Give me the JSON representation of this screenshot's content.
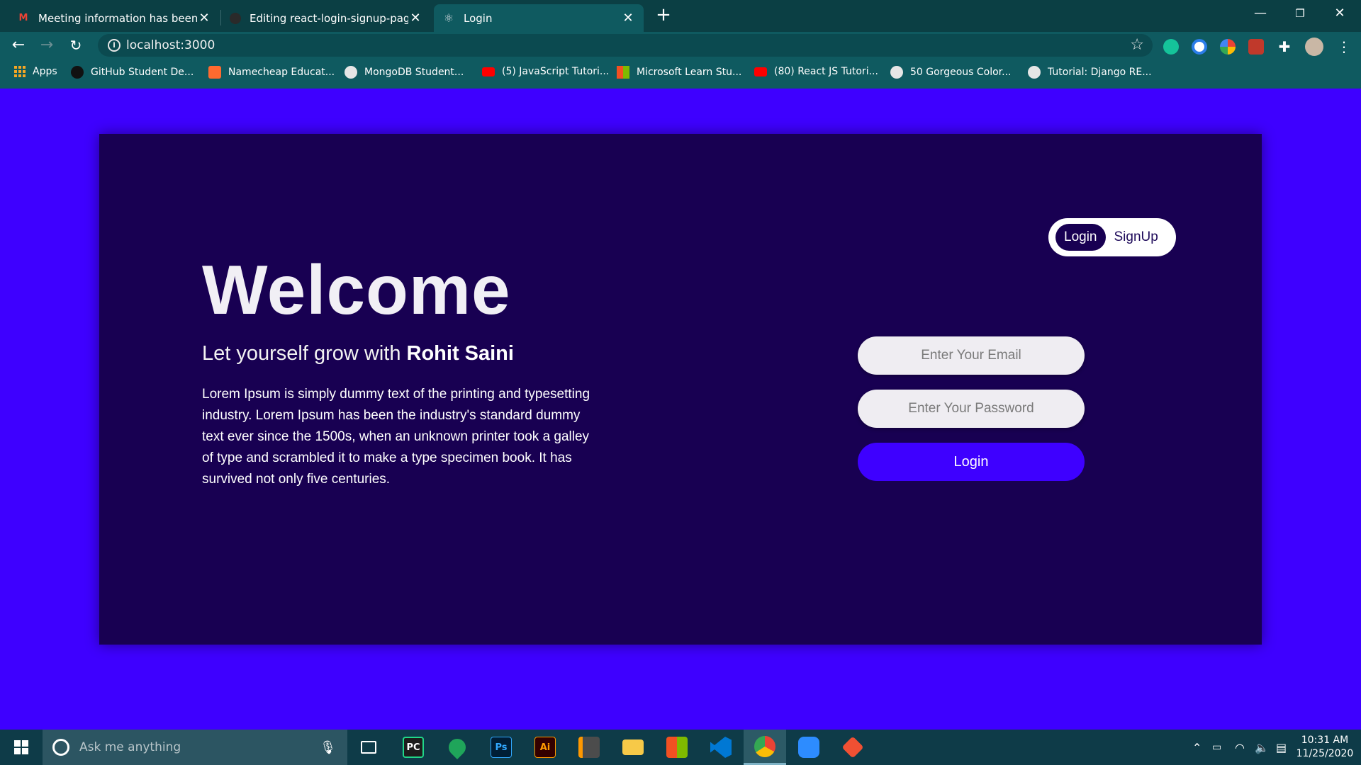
{
  "browser": {
    "tabs": [
      {
        "title": "Meeting information has been up",
        "favicon": "gmail-icon"
      },
      {
        "title": "Editing react-login-signup-page/",
        "favicon": "github-icon"
      },
      {
        "title": "Login",
        "favicon": "react-icon"
      }
    ],
    "new_tab": "+",
    "url": "localhost:3000",
    "bookmarks": [
      {
        "label": "Apps"
      },
      {
        "label": "GitHub Student De..."
      },
      {
        "label": "Namecheap Educat..."
      },
      {
        "label": "MongoDB Student..."
      },
      {
        "label": "(5) JavaScript Tutori..."
      },
      {
        "label": "Microsoft Learn Stu..."
      },
      {
        "label": "(80) React JS Tutori..."
      },
      {
        "label": "50 Gorgeous Color..."
      },
      {
        "label": "Tutorial: Django RE..."
      }
    ]
  },
  "hero": {
    "title": "Welcome",
    "tagline_prefix": "Let yourself grow with ",
    "tagline_name": "Rohit Saini",
    "description": "Lorem Ipsum is simply dummy text of the printing and typesetting industry. Lorem Ipsum has been the industry's standard dummy text ever since the 1500s, when an unknown printer took a galley of type and scrambled it to make a type specimen book. It has survived not only five centuries."
  },
  "toggle": {
    "login": "Login",
    "signup": "SignUp",
    "active": "Login"
  },
  "form": {
    "email_placeholder": "Enter Your Email",
    "password_placeholder": "Enter Your Password",
    "submit_label": "Login"
  },
  "taskbar": {
    "search_placeholder": "Ask me anything",
    "apps": [
      "PC",
      "Ps",
      "Ai"
    ],
    "time": "10:31 AM",
    "date": "11/25/2020"
  },
  "colors": {
    "page_bg": "#3e00ff",
    "card_bg": "#180052",
    "button_bg": "#3e00ff",
    "chrome_bg": "#0f5a60"
  }
}
